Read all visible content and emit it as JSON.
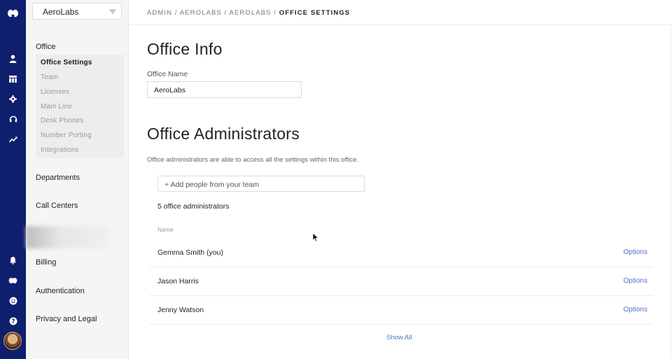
{
  "office_selector": {
    "value": "AeroLabs"
  },
  "nav": {
    "office_heading": "Office",
    "office_items": [
      {
        "label": "Office Settings"
      },
      {
        "label": "Team"
      },
      {
        "label": "Licenses"
      },
      {
        "label": "Main Line"
      },
      {
        "label": "Desk Phones"
      },
      {
        "label": "Number Porting"
      },
      {
        "label": "Integrations"
      }
    ],
    "departments": "Departments",
    "call_centers": "Call Centers",
    "billing": "Billing",
    "authentication": "Authentication",
    "privacy": "Privacy and Legal"
  },
  "rail_icons": [
    "logo-icon",
    "person-icon",
    "team-icon",
    "gear-icon",
    "headset-icon",
    "trend-icon",
    "bell-icon",
    "logo-small-icon",
    "smiley-icon",
    "help-icon",
    "avatar"
  ],
  "breadcrumb": {
    "part1": "ADMIN / AEROLABS / AEROLABS / ",
    "current": "OFFICE SETTINGS"
  },
  "office_info": {
    "title": "Office Info",
    "name_label": "Office Name",
    "name_value": "AeroLabs"
  },
  "admins": {
    "title": "Office Administrators",
    "description": "Office administrators are able to access all the settings within this office.",
    "add_placeholder": "+ Add people from your team",
    "count_text": "5 office administrators",
    "column_name": "Name",
    "rows": [
      {
        "name": "Gemma Smith (you)",
        "action": "Options"
      },
      {
        "name": "Jason Harris",
        "action": "Options"
      },
      {
        "name": "Jenny Watson",
        "action": "Options"
      }
    ],
    "show_all": "Show All"
  },
  "colors": {
    "rail": "#0e1f6e",
    "link": "#4a73c8",
    "nav_bg": "#f5f5f4"
  }
}
